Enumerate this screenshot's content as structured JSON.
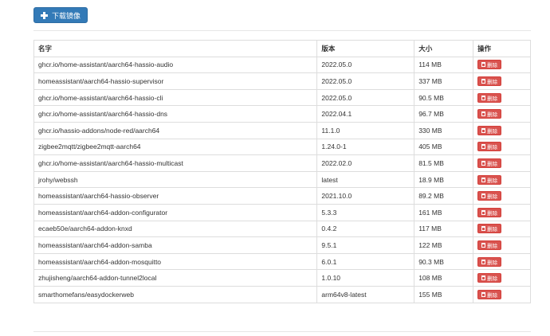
{
  "toolbar": {
    "download_label": "下载镜像",
    "download_icon": "plus-icon"
  },
  "table": {
    "headers": {
      "name": "名字",
      "version": "版本",
      "size": "大小",
      "actions": "操作"
    },
    "delete_label": "删除",
    "delete_icon": "trash-icon",
    "rows": [
      {
        "name": "ghcr.io/home-assistant/aarch64-hassio-audio",
        "version": "2022.05.0",
        "size": "114 MB"
      },
      {
        "name": "homeassistant/aarch64-hassio-supervisor",
        "version": "2022.05.0",
        "size": "337 MB"
      },
      {
        "name": "ghcr.io/home-assistant/aarch64-hassio-cli",
        "version": "2022.05.0",
        "size": "90.5 MB"
      },
      {
        "name": "ghcr.io/home-assistant/aarch64-hassio-dns",
        "version": "2022.04.1",
        "size": "96.7 MB"
      },
      {
        "name": "ghcr.io/hassio-addons/node-red/aarch64",
        "version": "11.1.0",
        "size": "330 MB"
      },
      {
        "name": "zigbee2mqtt/zigbee2mqtt-aarch64",
        "version": "1.24.0-1",
        "size": "405 MB"
      },
      {
        "name": "ghcr.io/home-assistant/aarch64-hassio-multicast",
        "version": "2022.02.0",
        "size": "81.5 MB"
      },
      {
        "name": "jrohy/webssh",
        "version": "latest",
        "size": "18.9 MB"
      },
      {
        "name": "homeassistant/aarch64-hassio-observer",
        "version": "2021.10.0",
        "size": "89.2 MB"
      },
      {
        "name": "homeassistant/aarch64-addon-configurator",
        "version": "5.3.3",
        "size": "161 MB"
      },
      {
        "name": "ecaeb50e/aarch64-addon-knxd",
        "version": "0.4.2",
        "size": "117 MB"
      },
      {
        "name": "homeassistant/aarch64-addon-samba",
        "version": "9.5.1",
        "size": "122 MB"
      },
      {
        "name": "homeassistant/aarch64-addon-mosquitto",
        "version": "6.0.1",
        "size": "90.3 MB"
      },
      {
        "name": "zhujisheng/aarch64-addon-tunnel2local",
        "version": "1.0.10",
        "size": "108 MB"
      },
      {
        "name": "smarthomefans/easydockerweb",
        "version": "arm64v8-latest",
        "size": "155 MB"
      }
    ]
  },
  "colors": {
    "primary": "#337ab7",
    "danger": "#d9534f",
    "border": "#dddddd"
  }
}
